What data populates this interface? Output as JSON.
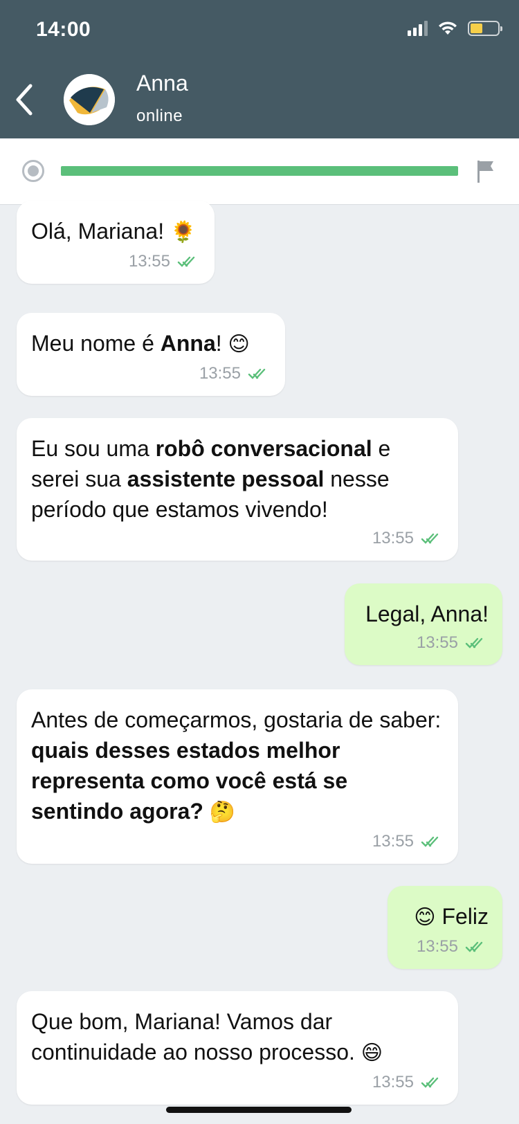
{
  "status_bar": {
    "time": "14:00"
  },
  "header": {
    "contact_name": "Anna",
    "contact_status": "online"
  },
  "progress": {
    "fraction": 1.0
  },
  "colors": {
    "header_bg": "#455a64",
    "incoming_bg": "#ffffff",
    "outgoing_bg": "#dcfbc6",
    "accent": "#5bbf7a",
    "tick": "#5bbf7a"
  },
  "messages": [
    {
      "direction": "in",
      "parts": [
        {
          "t": "Olá, Mariana! "
        },
        {
          "t": "🌻",
          "emoji": true
        }
      ],
      "time": "13:55"
    },
    {
      "direction": "in",
      "parts": [
        {
          "t": "Meu nome é "
        },
        {
          "t": "Anna",
          "b": true
        },
        {
          "t": "! "
        },
        {
          "t": "😊",
          "emoji": true
        }
      ],
      "time": "13:55"
    },
    {
      "direction": "in",
      "parts": [
        {
          "t": "Eu sou uma "
        },
        {
          "t": "robô conversacional",
          "b": true
        },
        {
          "t": " e serei sua "
        },
        {
          "t": "assistente pessoal",
          "b": true
        },
        {
          "t": " nesse período que estamos vivendo!"
        }
      ],
      "time": "13:55"
    },
    {
      "direction": "out",
      "parts": [
        {
          "t": "Legal, Anna!"
        }
      ],
      "time": "13:55"
    },
    {
      "direction": "in",
      "parts": [
        {
          "t": "Antes de começarmos, gostaria de saber: "
        },
        {
          "t": "quais desses estados melhor representa como você está se sentindo agora?",
          "b": true
        },
        {
          "t": " "
        },
        {
          "t": "🤔",
          "emoji": true
        }
      ],
      "time": "13:55"
    },
    {
      "direction": "out",
      "parts": [
        {
          "t": "😊",
          "emoji": true
        },
        {
          "t": " Feliz"
        }
      ],
      "time": "13:55"
    },
    {
      "direction": "in",
      "parts": [
        {
          "t": "Que bom, Mariana! Vamos dar continuidade ao nosso processo. "
        },
        {
          "t": "😄",
          "emoji": true
        }
      ],
      "time": "13:55"
    }
  ]
}
